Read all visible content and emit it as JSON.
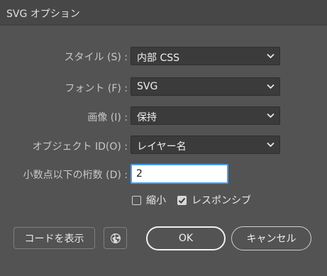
{
  "window": {
    "title": "SVG オプション"
  },
  "fields": {
    "styles": {
      "label": "スタイル (S) :",
      "value": "内部 CSS"
    },
    "font": {
      "label": "フォント (F) :",
      "value": "SVG"
    },
    "images": {
      "label": "画像 (I) :",
      "value": "保持"
    },
    "object_ids": {
      "label": "オブジェクト ID(O) :",
      "value": "レイヤー名"
    },
    "decimal_places": {
      "label": "小数点以下の桁数 (D) :",
      "value": "2"
    }
  },
  "checkboxes": {
    "minify": {
      "label": "縮小",
      "checked": false
    },
    "responsive": {
      "label": "レスポンシブ",
      "checked": true
    }
  },
  "buttons": {
    "show_code": "コードを表示",
    "web_preview_icon": "globe-icon",
    "ok": "OK",
    "cancel": "キャンセル"
  },
  "icons": {
    "dropdown": "chevron-down-icon",
    "checkmark": "checkmark-icon"
  },
  "colors": {
    "background": "#535353",
    "focus_ring": "#46a0f5",
    "dropdown_bg": "#3b3b3b"
  }
}
